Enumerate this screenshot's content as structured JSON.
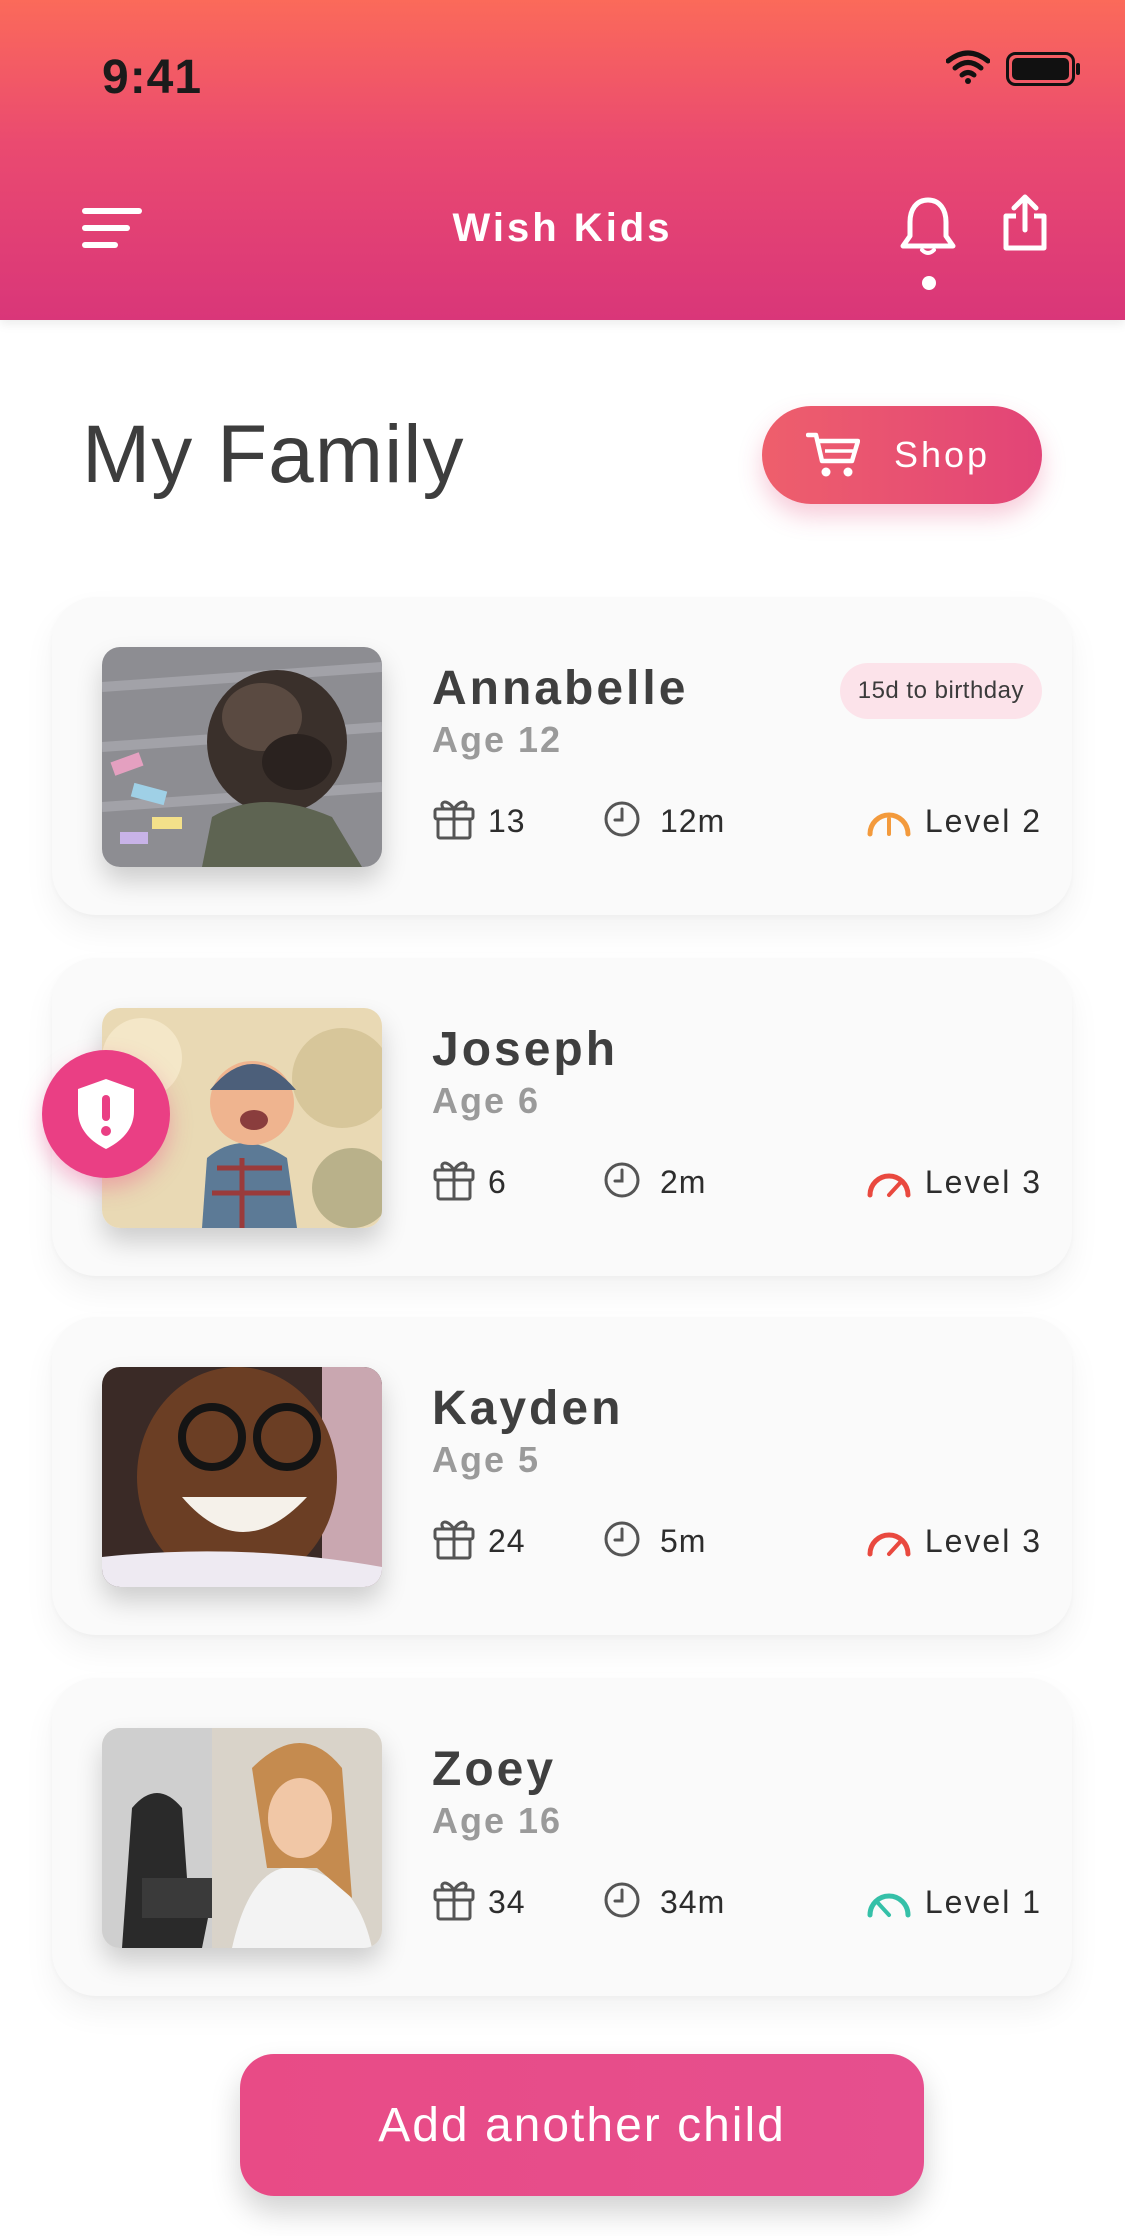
{
  "status_bar": {
    "time": "9:41"
  },
  "header": {
    "title": "Wish Kids",
    "icons": [
      "menu-icon",
      "bell-icon",
      "share-icon"
    ]
  },
  "page": {
    "title": "My Family"
  },
  "shop": {
    "label": "Shop",
    "icon": "cart-icon"
  },
  "children": [
    {
      "name": "Annabelle",
      "age": "Age 12",
      "badge": "15d to birthday",
      "gifts": "13",
      "time": "12m",
      "level": "Level 2",
      "level_color": "#f39a3c",
      "level_value": 2
    },
    {
      "name": "Joseph",
      "age": "Age 6",
      "gifts": "6",
      "time": "2m",
      "level": "Level 3",
      "level_color": "#e9493f",
      "level_value": 3
    },
    {
      "name": "Kayden",
      "age": "Age 5",
      "gifts": "24",
      "time": "5m",
      "level": "Level 3",
      "level_color": "#e9493f",
      "level_value": 3
    },
    {
      "name": "Zoey",
      "age": "Age 16",
      "gifts": "34",
      "time": "34m",
      "level": "Level 1",
      "level_color": "#35c0a8",
      "level_value": 1
    }
  ],
  "alert": {
    "icon": "shield-alert-icon"
  },
  "footer": {
    "add_label": "Add another child"
  },
  "colors": {
    "accent": "#e24477",
    "header_top": "#fb6a5a",
    "header_bottom": "#d93679"
  }
}
